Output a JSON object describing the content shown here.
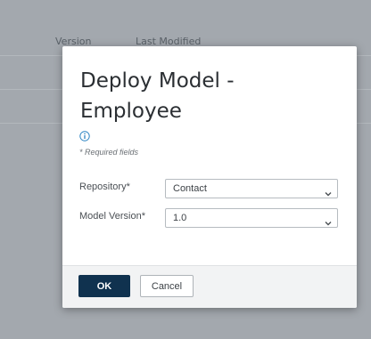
{
  "background": {
    "table_headers": [
      "Version",
      "Last Modified"
    ]
  },
  "dialog": {
    "title": "Deploy Model - Employee",
    "info_icon": "info-icon",
    "required_note": "* Required fields",
    "fields": [
      {
        "label": "Repository*",
        "value": "Contact"
      },
      {
        "label": "Model Version*",
        "value": "1.0"
      }
    ],
    "buttons": {
      "ok_label": "OK",
      "cancel_label": "Cancel"
    }
  },
  "colors": {
    "overlay_background": "#a3a8ae",
    "primary_button": "#10324f",
    "info_icon": "#2f86c4"
  }
}
